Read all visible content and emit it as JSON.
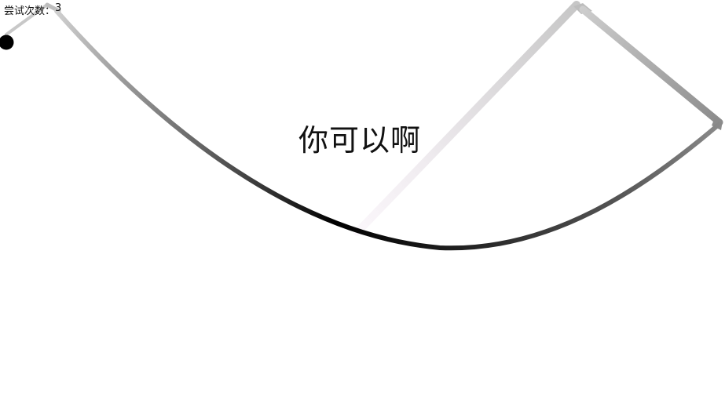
{
  "hud": {
    "attempts_label": "尝试次数：",
    "attempts_count": "3"
  },
  "game": {
    "message": "你可以啊",
    "ball_color": "#000000",
    "track_colors": {
      "light": "#d0d0d0",
      "mid": "#888888",
      "dark": "#000000",
      "highlight": "#f3f0f3"
    }
  }
}
